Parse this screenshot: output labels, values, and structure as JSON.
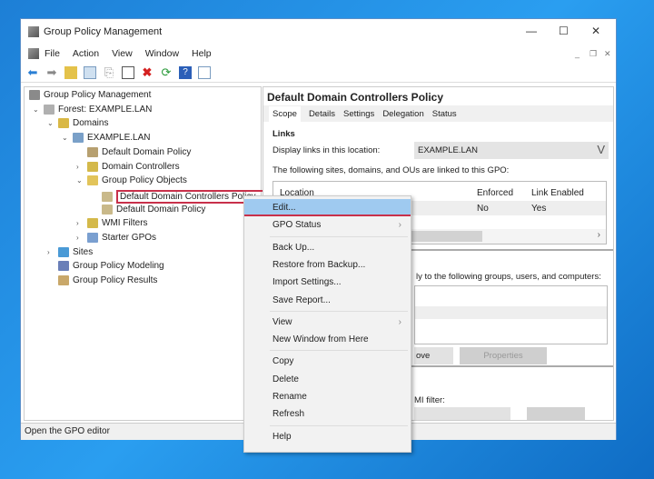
{
  "window": {
    "title": "Group Policy Management",
    "controls": [
      "—",
      "☐",
      "✕"
    ]
  },
  "menu": [
    "File",
    "Action",
    "View",
    "Window",
    "Help"
  ],
  "toolbar": [
    "back-icon",
    "forward-icon",
    "up-folder-icon",
    "show-hide-tree-icon",
    "copy-icon",
    "paste-icon",
    "delete-icon",
    "refresh-icon",
    "help-icon",
    "properties-icon"
  ],
  "tree": [
    {
      "label": "Group Policy Management",
      "level": 0,
      "expand": ""
    },
    {
      "label": "Forest: EXAMPLE.LAN",
      "level": 1,
      "expand": "v"
    },
    {
      "label": "Domains",
      "level": 2,
      "expand": "v"
    },
    {
      "label": "EXAMPLE.LAN",
      "level": 3,
      "expand": "v"
    },
    {
      "label": "Default Domain Policy",
      "level": 4,
      "expand": ""
    },
    {
      "label": "Domain Controllers",
      "level": 4,
      "expand": ">"
    },
    {
      "label": "Group Policy Objects",
      "level": 4,
      "expand": "v"
    },
    {
      "label": "Default Domain Controllers Policy",
      "level": 5,
      "expand": "",
      "selected": true
    },
    {
      "label": "Default Domain Policy",
      "level": 5,
      "expand": ""
    },
    {
      "label": "WMI Filters",
      "level": 4,
      "expand": ">"
    },
    {
      "label": "Starter GPOs",
      "level": 4,
      "expand": ">"
    },
    {
      "label": "Sites",
      "level": 2,
      "expand": ">"
    },
    {
      "label": "Group Policy Modeling",
      "level": 2,
      "expand": ""
    },
    {
      "label": "Group Policy Results",
      "level": 2,
      "expand": ""
    }
  ],
  "right": {
    "title": "Default Domain Controllers Policy",
    "tabs": [
      "Scope",
      "Details",
      "Settings",
      "Delegation",
      "Status"
    ],
    "links_heading": "Links",
    "display_links_label": "Display links in this location:",
    "display_links_value": "EXAMPLE.LAN",
    "linked_text": "The following sites, domains, and OUs are linked to this GPO:",
    "columns": [
      "Location",
      "Enforced",
      "Link Enabled"
    ],
    "row": {
      "enforced": "No",
      "link_enabled": "Yes"
    },
    "filter_text": "ly to the following groups, users, and computers:",
    "remove_btn": "ove",
    "properties_btn": "Properties",
    "wmi_text": "MI filter:"
  },
  "status": "Open the GPO editor",
  "context_menu": [
    {
      "label": "Edit...",
      "highlight": true
    },
    {
      "label": "GPO Status",
      "submenu": true
    },
    {
      "sep": true
    },
    {
      "label": "Back Up..."
    },
    {
      "label": "Restore from Backup..."
    },
    {
      "label": "Import Settings..."
    },
    {
      "label": "Save Report..."
    },
    {
      "sep": true
    },
    {
      "label": "View",
      "submenu": true
    },
    {
      "label": "New Window from Here"
    },
    {
      "sep": true
    },
    {
      "label": "Copy"
    },
    {
      "label": "Delete"
    },
    {
      "label": "Rename"
    },
    {
      "label": "Refresh"
    },
    {
      "sep": true
    },
    {
      "label": "Help"
    }
  ],
  "colors": {
    "highlight": "#9fcaf0",
    "selection_border": "#c8304a",
    "desktop": "#1d86e0"
  }
}
